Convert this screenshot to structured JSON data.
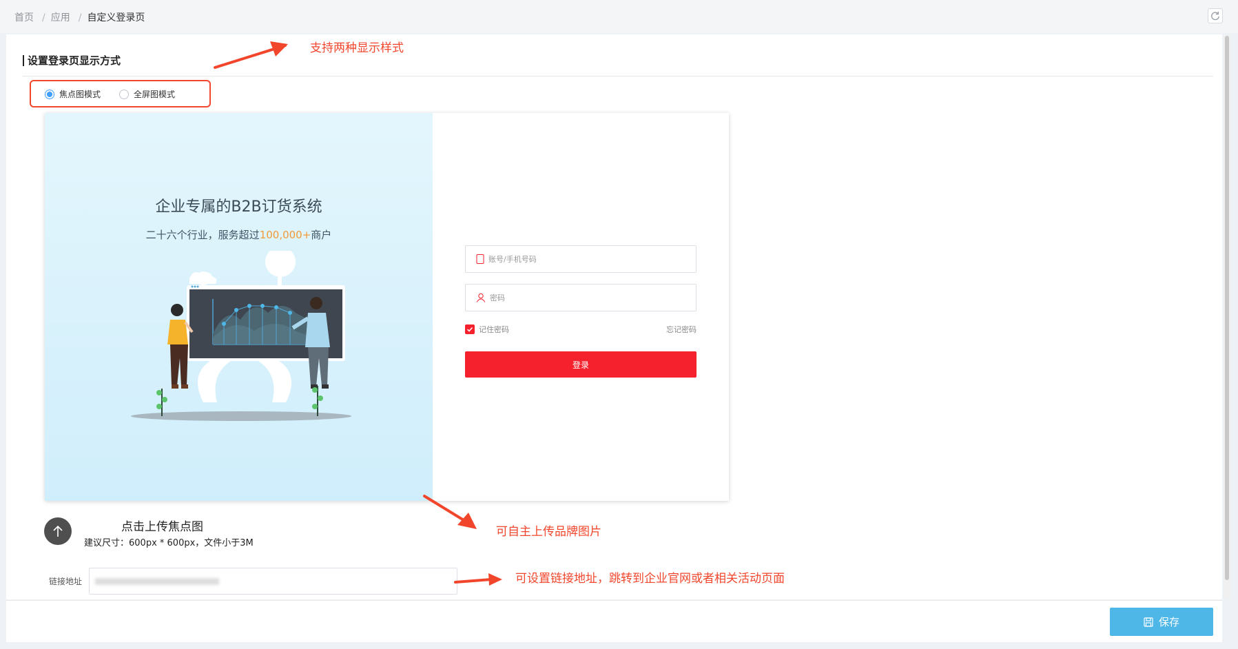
{
  "breadcrumb": {
    "home": "首页",
    "apps": "应用",
    "current": "自定义登录页"
  },
  "section": {
    "title": "设置登录页显示方式"
  },
  "display_mode": {
    "options": [
      {
        "label": "焦点图模式",
        "checked": true
      },
      {
        "label": "全屏图模式",
        "checked": false
      }
    ]
  },
  "preview": {
    "headline": "企业专属的B2B订货系统",
    "sub_prefix": "二十六个行业，服务超过",
    "sub_highlight": "100,000+",
    "sub_suffix": "商户",
    "account_placeholder": "账号/手机号码",
    "password_placeholder": "密码",
    "remember": "记住密码",
    "forgot": "忘记密码",
    "login": "登录",
    "brand_color": "#f5222d"
  },
  "upload": {
    "title": "点击上传焦点图",
    "hint": "建议尺寸：600px * 600px，文件小于3M"
  },
  "link": {
    "label": "链接地址",
    "value_blurred": true
  },
  "footer": {
    "save": "保存"
  },
  "annotations": {
    "styles": "支持两种显示样式",
    "brand_image": "可自主上传品牌图片",
    "link": "可设置链接地址，跳转到企业官网或者相关活动页面"
  },
  "colors": {
    "accent": "#409eff",
    "save": "#4fb7e7",
    "annotation": "#f2462c"
  }
}
